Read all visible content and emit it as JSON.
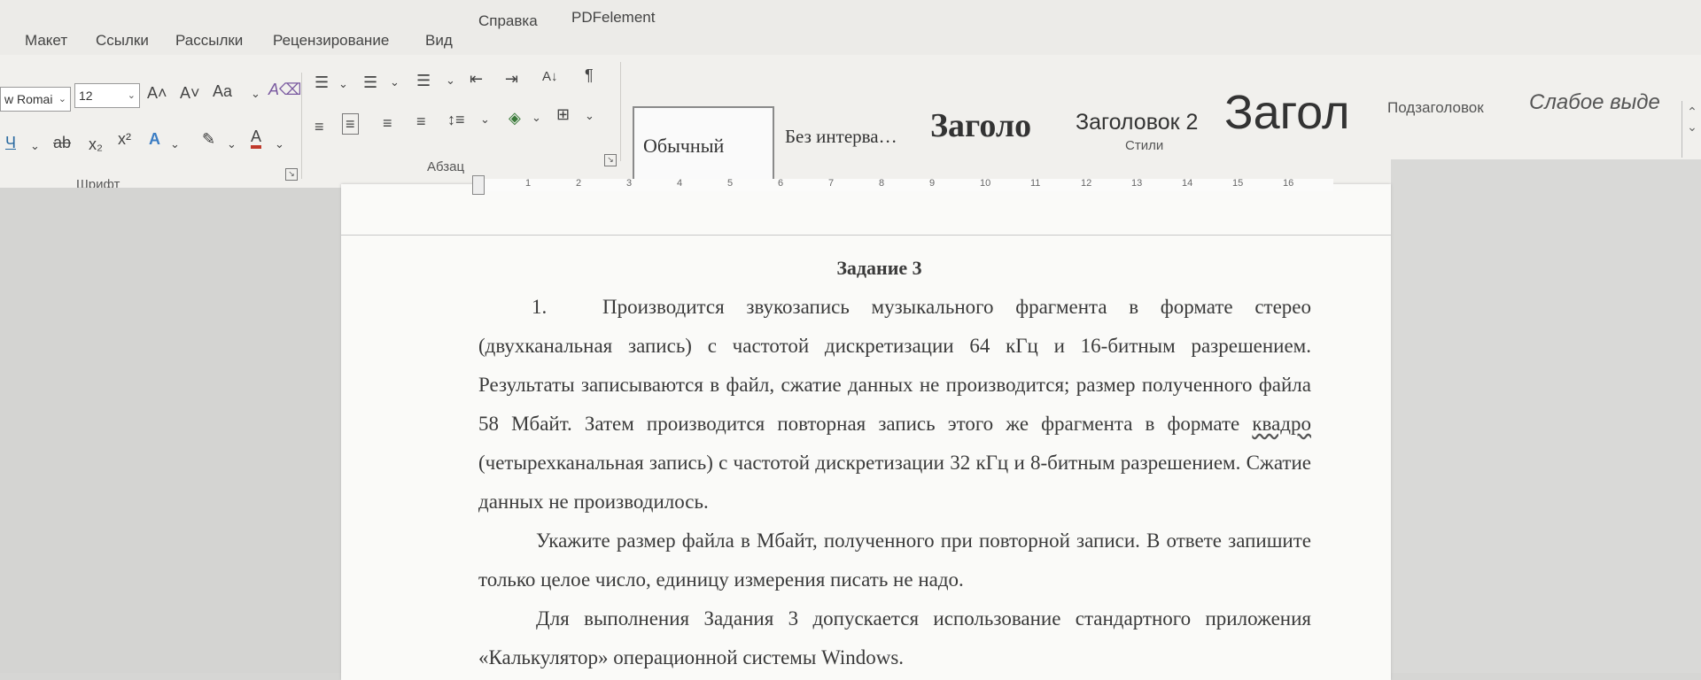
{
  "ribbon_tabs": [
    "Макет",
    "Ссылки",
    "Рассылки",
    "Рецензирование",
    "Вид",
    "Справка",
    "PDFelement"
  ],
  "font_group": {
    "font_name": "w Romai",
    "font_size": "12",
    "grow_font": "A˄",
    "shrink_font": "A˅",
    "change_case": "Aa",
    "underline": "Ч",
    "strikethrough": "ab",
    "subscript": "x₂",
    "superscript": "x²",
    "text_effects": "A",
    "font_color": "A",
    "label": "Шрифт"
  },
  "paragraph_group": {
    "sort": "A↓",
    "pilcrow": "¶",
    "label": "Абзац"
  },
  "styles_group": {
    "items": [
      {
        "label": "Обычный",
        "selected": true
      },
      {
        "label": "Без интерва…",
        "selected": false
      },
      {
        "label": "Заголо",
        "selected": false
      },
      {
        "label": "Заголовок 2",
        "selected": false
      },
      {
        "label": "Загол",
        "selected": false
      },
      {
        "label": "Подзаголовок",
        "selected": false
      },
      {
        "label": "Слабое выде",
        "selected": false
      }
    ],
    "label": "Стили"
  },
  "ruler": {
    "numbers": [
      "1",
      "2",
      "3",
      "4",
      "5",
      "6",
      "7",
      "8",
      "9",
      "10",
      "11",
      "12",
      "13",
      "14",
      "15",
      "16"
    ]
  },
  "document": {
    "title": "Задание 3",
    "item_number": "1.",
    "p1_before": "Производится звукозапись музыкального фрагмента в формате стерео (двухканальная запись) с частотой дискретизации 64 кГц и 16-битным разрешением. Результаты записываются в файл, сжатие данных не производится; размер полученного файла 58 Мбайт. Затем производится повторная запись этого же фрагмента в формате ",
    "p1_marked": "квадро",
    "p1_after": " (четырехканальная запись) с частотой дискретизации 32 кГц и 8-битным разрешением. Сжатие данных не производилось.",
    "p2": "Укажите размер файла в Мбайт, полученного при повторной записи. В ответе запишите только целое число, единицу измерения писать не надо.",
    "p3": "Для выполнения Задания 3 допускается использование стандартного приложения «Калькулятор» операционной системы Windows."
  }
}
